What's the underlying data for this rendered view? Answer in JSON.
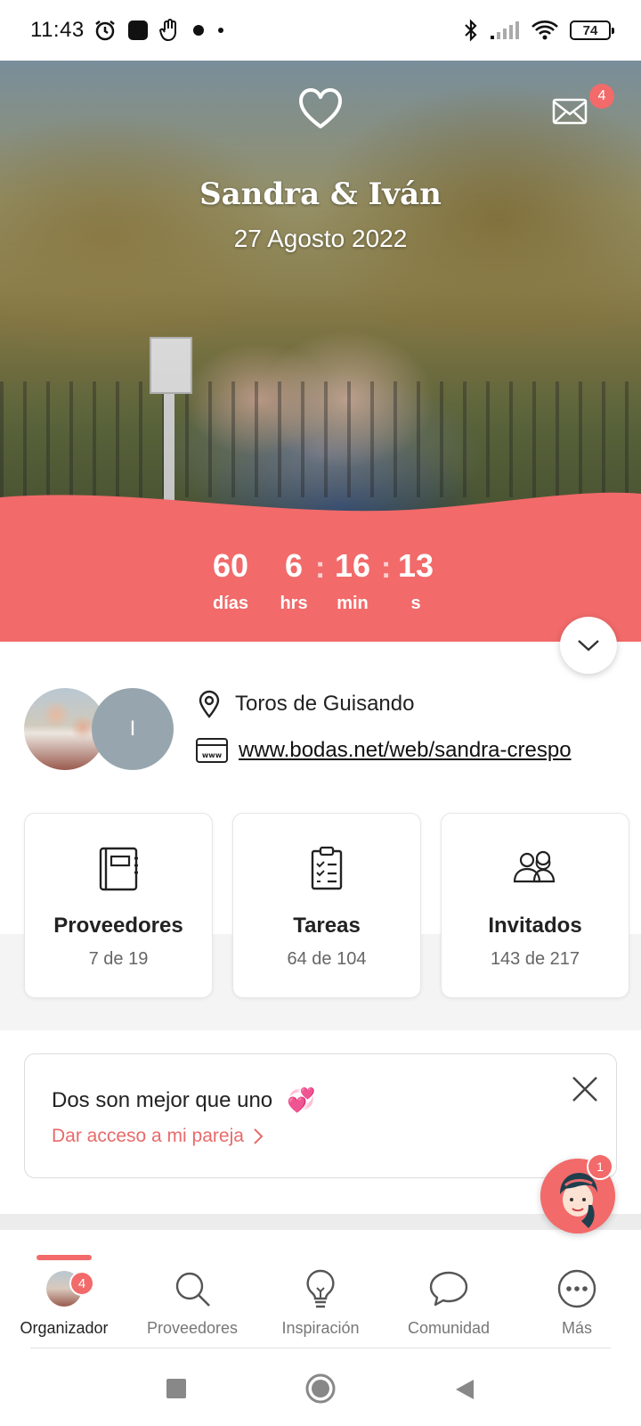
{
  "status_bar": {
    "time": "11:43",
    "battery": "74",
    "icons_left": [
      "alarm-icon",
      "app-icon",
      "hand-icon",
      "chat-bubble-icon",
      "dot-icon"
    ],
    "icons_right": [
      "bluetooth-icon",
      "signal-icon",
      "wifi-icon",
      "battery-icon"
    ]
  },
  "hero": {
    "couple_names": "Sandra & Iván",
    "wedding_date": "27 Agosto 2022",
    "mail_badge": "4"
  },
  "countdown": {
    "days": "60",
    "days_label": "días",
    "hours": "6",
    "hours_label": "hrs",
    "minutes": "16",
    "minutes_label": "min",
    "seconds": "13",
    "seconds_label": "s"
  },
  "profile": {
    "partner_initial": "I",
    "location": "Toros de Guisando",
    "website": "www.bodas.net/web/sandra-crespo"
  },
  "stats": [
    {
      "title": "Proveedores",
      "sub": "7 de 19"
    },
    {
      "title": "Tareas",
      "sub": "64 de 104"
    },
    {
      "title": "Invitados",
      "sub": "143 de 217"
    }
  ],
  "promo": {
    "title": "Dos son mejor que uno",
    "emoji": "💞",
    "link": "Dar acceso a mi pareja"
  },
  "chat_badge": "1",
  "bottom_nav": {
    "badge": "4",
    "items": [
      {
        "label": "Organizador"
      },
      {
        "label": "Proveedores"
      },
      {
        "label": "Inspiración"
      },
      {
        "label": "Comunidad"
      },
      {
        "label": "Más"
      }
    ]
  },
  "colors": {
    "accent": "#f26a6a",
    "countdown_band": "#f26a6a"
  }
}
